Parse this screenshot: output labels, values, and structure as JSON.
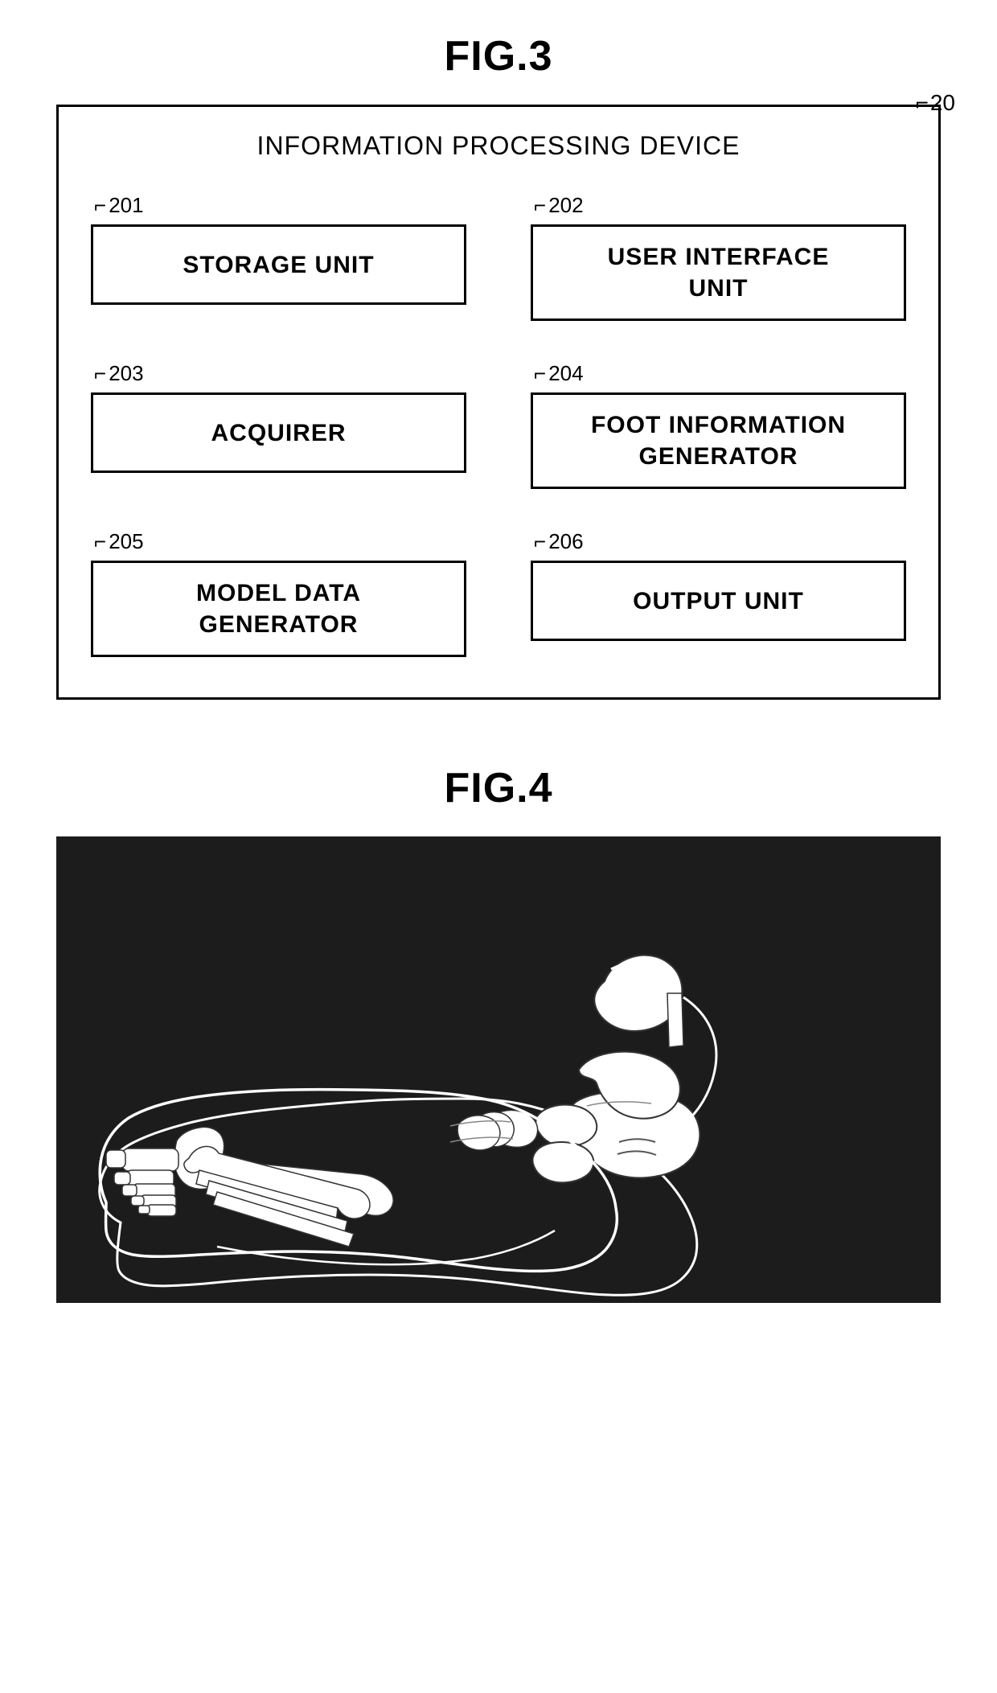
{
  "fig3": {
    "title": "FIG.3",
    "device_ref": "20",
    "device_label": "INFORMATION PROCESSING DEVICE",
    "units": [
      {
        "ref": "201",
        "label": "STORAGE UNIT",
        "multiline": false
      },
      {
        "ref": "202",
        "label": "USER INTERFACE\nUNIT",
        "multiline": true
      },
      {
        "ref": "203",
        "label": "ACQUIRER",
        "multiline": false
      },
      {
        "ref": "204",
        "label": "FOOT INFORMATION\nGENERATOR",
        "multiline": true
      },
      {
        "ref": "205",
        "label": "MODEL DATA\nGENERATOR",
        "multiline": true
      },
      {
        "ref": "206",
        "label": "OUTPUT UNIT",
        "multiline": false
      }
    ]
  },
  "fig4": {
    "title": "FIG.4"
  }
}
